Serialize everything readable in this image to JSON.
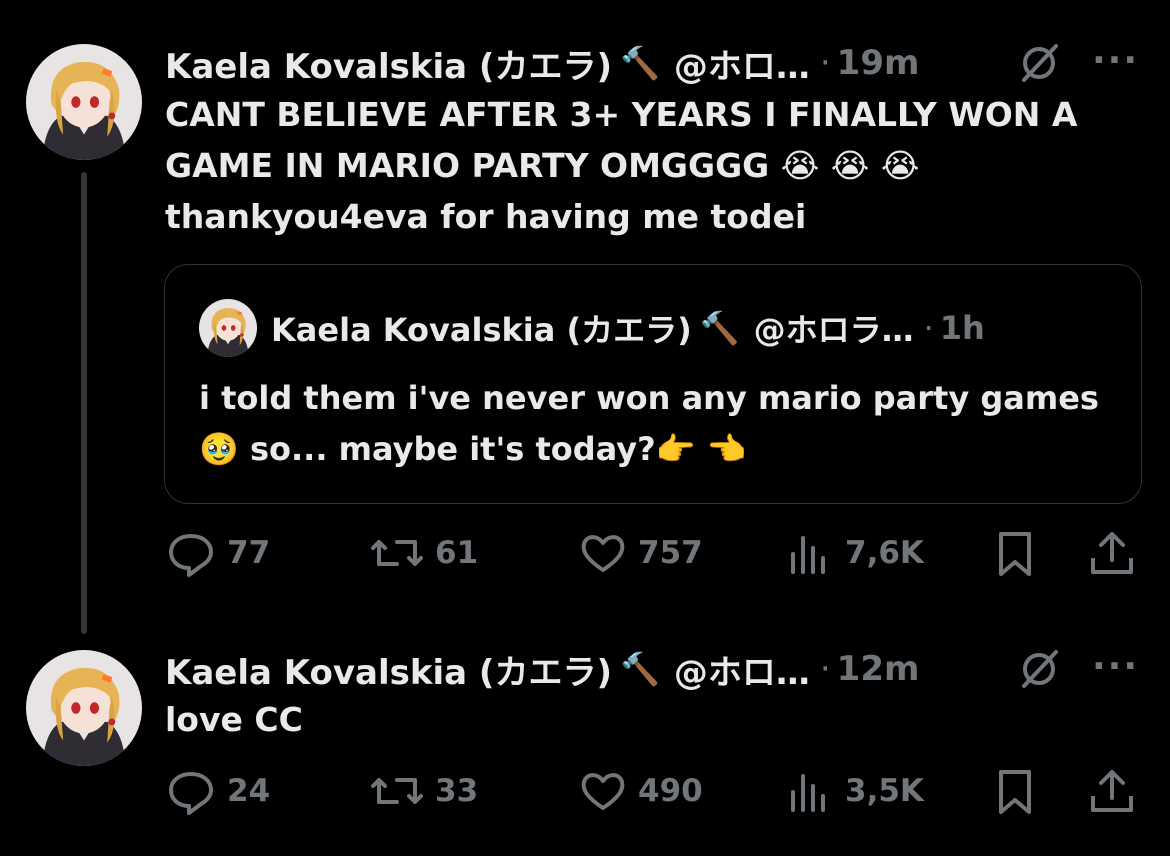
{
  "tweets": [
    {
      "author": "Kaela Kovalskia (カエラ)",
      "badge_icon": "hammer-icon",
      "handle": "@ホロ…",
      "separator": "·",
      "time": "19m",
      "text": "CANT BELIEVE AFTER 3+ YEARS I FINALLY WON A GAME IN MARIO PARTY OMGGGG 😭 😭 😭\nthankyou4eva for having me todei",
      "quote": {
        "author": "Kaela Kovalskia (カエラ)",
        "handle": "@ホロラ…",
        "separator": "·",
        "time": "1h",
        "text": "i told them i've never won any mario party games 🥹  so... maybe it's today?👉 👈"
      },
      "stats": {
        "replies": "77",
        "retweets": "61",
        "likes": "757",
        "views": "7,6K"
      }
    },
    {
      "author": "Kaela Kovalskia (カエラ)",
      "badge_icon": "hammer-icon",
      "handle": "@ホロ…",
      "separator": "·",
      "time": "12m",
      "text": "love CC",
      "stats": {
        "replies": "24",
        "retweets": "33",
        "likes": "490",
        "views": "3,5K"
      }
    }
  ],
  "more_label": "···",
  "icons": [
    "grok-icon",
    "more-icon",
    "reply-icon",
    "retweet-icon",
    "like-icon",
    "views-icon",
    "bookmark-icon",
    "share-icon"
  ],
  "colors": {
    "background": "#000000",
    "text": "#e7e9ea",
    "muted": "#71767b",
    "border": "#2f3336"
  }
}
